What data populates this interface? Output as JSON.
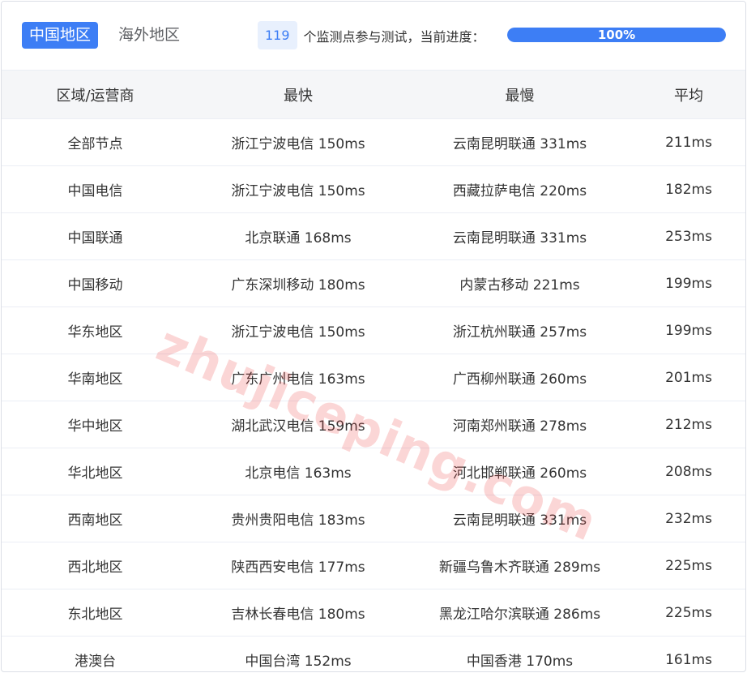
{
  "tabs": [
    {
      "label": "中国地区",
      "active": true
    },
    {
      "label": "海外地区",
      "active": false
    }
  ],
  "progress": {
    "count": "119",
    "text": "个监测点参与测试，当前进度：",
    "percent_label": "100%",
    "value": 100
  },
  "table": {
    "headers": [
      "区域/运营商",
      "最快",
      "最慢",
      "平均"
    ],
    "rows": [
      [
        "全部节点",
        "浙江宁波电信 150ms",
        "云南昆明联通 331ms",
        "211ms"
      ],
      [
        "中国电信",
        "浙江宁波电信 150ms",
        "西藏拉萨电信 220ms",
        "182ms"
      ],
      [
        "中国联通",
        "北京联通 168ms",
        "云南昆明联通 331ms",
        "253ms"
      ],
      [
        "中国移动",
        "广东深圳移动 180ms",
        "内蒙古移动 221ms",
        "199ms"
      ],
      [
        "华东地区",
        "浙江宁波电信 150ms",
        "浙江杭州联通 257ms",
        "199ms"
      ],
      [
        "华南地区",
        "广东广州电信 163ms",
        "广西柳州联通 260ms",
        "201ms"
      ],
      [
        "华中地区",
        "湖北武汉电信 159ms",
        "河南郑州联通 278ms",
        "212ms"
      ],
      [
        "华北地区",
        "北京电信 163ms",
        "河北邯郸联通 260ms",
        "208ms"
      ],
      [
        "西南地区",
        "贵州贵阳电信 183ms",
        "云南昆明联通 331ms",
        "232ms"
      ],
      [
        "西北地区",
        "陕西西安电信 177ms",
        "新疆乌鲁木齐联通 289ms",
        "225ms"
      ],
      [
        "东北地区",
        "吉林长春电信 180ms",
        "黑龙江哈尔滨联通 286ms",
        "225ms"
      ],
      [
        "港澳台",
        "中国台湾 152ms",
        "中国香港 170ms",
        "161ms"
      ]
    ]
  },
  "watermark": "zhujiceping.com",
  "colors": {
    "accent": "#3d7ef5",
    "badge_bg": "#e8f0fd",
    "header_bg": "#f5f6f8",
    "watermark": "#eb4646"
  }
}
